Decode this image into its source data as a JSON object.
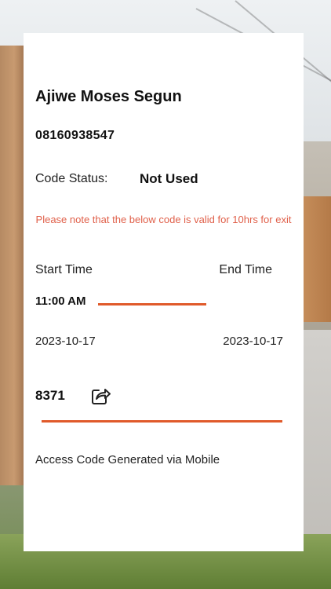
{
  "user": {
    "name": "Ajiwe Moses Segun",
    "phone": "08160938547"
  },
  "status": {
    "label": "Code Status:",
    "value": "Not Used"
  },
  "notice": "Please note that the below code is valid for 10hrs for exit",
  "times": {
    "start_label": "Start Time",
    "end_label": "End Time",
    "start_time": "11:00 AM",
    "start_date": "2023-10-17",
    "end_date": "2023-10-17"
  },
  "code": {
    "value": "8371",
    "share_icon": "share-icon"
  },
  "footer": "Access Code Generated via Mobile",
  "colors": {
    "accent": "#e05a2b",
    "notice": "#e0604a",
    "card": "#ffffff"
  }
}
